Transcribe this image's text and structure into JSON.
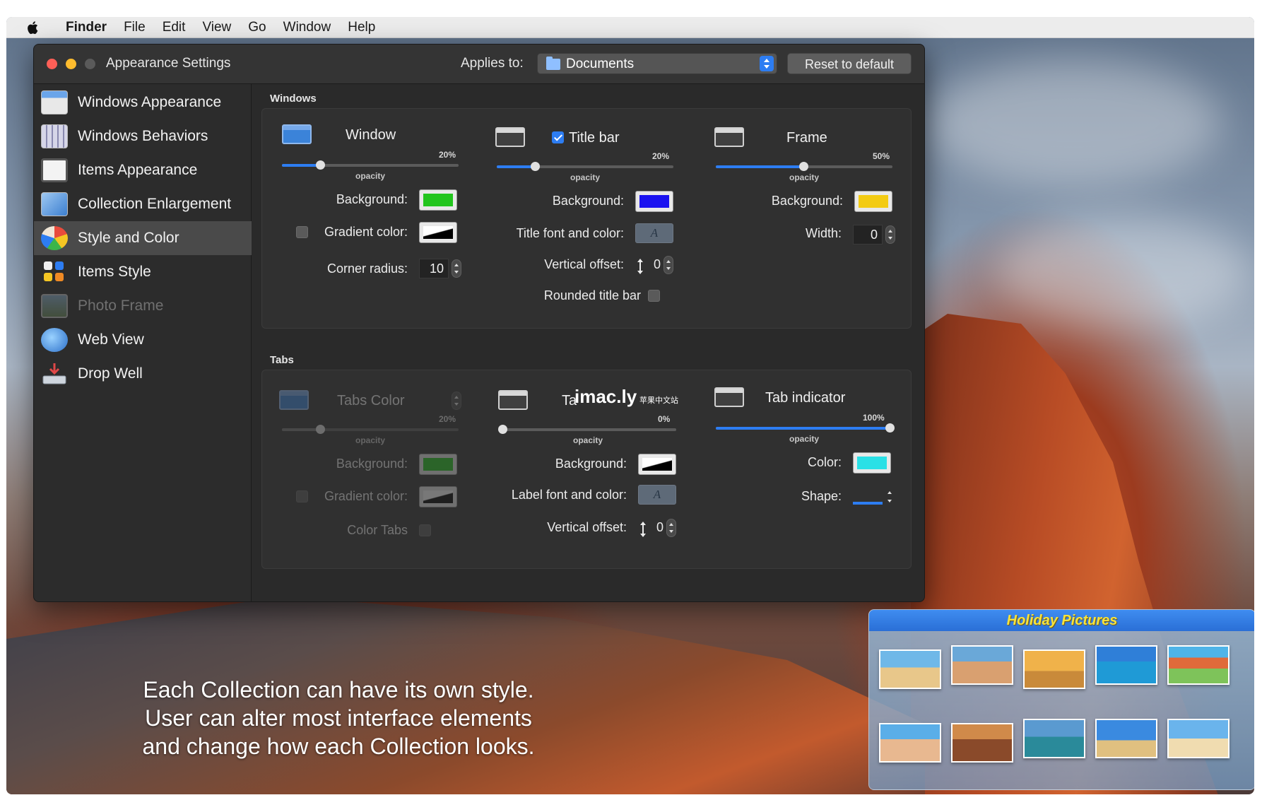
{
  "menubar": {
    "app": "Finder",
    "items": [
      "File",
      "Edit",
      "View",
      "Go",
      "Window",
      "Help"
    ]
  },
  "window": {
    "title": "Appearance Settings",
    "applies_label": "Applies to:",
    "applies_value": "Documents",
    "reset_label": "Reset to default"
  },
  "sidebar": {
    "selected": "Style and Color",
    "items": [
      {
        "label": "Windows Appearance",
        "icon": "windows-appearance-icon"
      },
      {
        "label": "Windows Behaviors",
        "icon": "windows-behaviors-icon"
      },
      {
        "label": "Items Appearance",
        "icon": "items-appearance-icon"
      },
      {
        "label": "Collection Enlargement",
        "icon": "collection-enlargement-icon"
      },
      {
        "label": "Style and Color",
        "icon": "palette-icon"
      },
      {
        "label": "Items Style",
        "icon": "items-style-icon"
      },
      {
        "label": "Photo Frame",
        "icon": "photo-frame-icon"
      },
      {
        "label": "Web View",
        "icon": "globe-icon"
      },
      {
        "label": "Drop Well",
        "icon": "drop-well-icon"
      }
    ]
  },
  "windows_section": {
    "label": "Windows",
    "window_col": {
      "title": "Window",
      "opacity_pct": "20%",
      "opacity_value": 0.2,
      "opacity_label": "opacity",
      "background_label": "Background:",
      "background_color": "#22c51d",
      "gradient_label": "Gradient color:",
      "gradient_checked": false,
      "corner_label": "Corner radius:",
      "corner_value": "10"
    },
    "titlebar_col": {
      "title": "Title bar",
      "checked": true,
      "opacity_pct": "20%",
      "opacity_value": 0.2,
      "opacity_label": "opacity",
      "background_label": "Background:",
      "background_color": "#1a12f0",
      "font_label": "Title font and color:",
      "font_glyph": "A",
      "offset_label": "Vertical offset:",
      "offset_value": "0",
      "rounded_label": "Rounded title bar",
      "rounded_checked": false
    },
    "frame_col": {
      "title": "Frame",
      "opacity_pct": "50%",
      "opacity_value": 0.5,
      "opacity_label": "opacity",
      "background_label": "Background:",
      "background_color": "#f3cb12",
      "width_label": "Width:",
      "width_value": "0"
    }
  },
  "tabs_section": {
    "label": "Tabs",
    "tabs_color_col": {
      "title": "Tabs Color",
      "opacity_pct": "20%",
      "opacity_value": 0.2,
      "opacity_label": "opacity",
      "background_label": "Background:",
      "background_color": "#22c51d",
      "gradient_label": "Gradient color:",
      "color_tabs_label": "Color Tabs"
    },
    "tab_col": {
      "title": "Ta",
      "opacity_pct": "0%",
      "opacity_value": 0.0,
      "opacity_label": "opacity",
      "background_label": "Background:",
      "font_label": "Label font and color:",
      "font_glyph": "A",
      "offset_label": "Vertical offset:",
      "offset_value": "0"
    },
    "indicator_col": {
      "title": "Tab indicator",
      "opacity_pct": "100%",
      "opacity_value": 1.0,
      "opacity_label": "opacity",
      "color_label": "Color:",
      "color_value": "#2ae0e6",
      "shape_label": "Shape:"
    }
  },
  "watermark": {
    "main": "imac.ly",
    "sub": "苹果中文站"
  },
  "tagline": [
    "Each Collection can have its own style.",
    "User can alter most interface elements",
    "and change how each Collection looks."
  ],
  "collection": {
    "title": "Holiday Pictures",
    "thumbnails": [
      "starfish-beach",
      "family-beach",
      "sunset-beach",
      "swimmer-sea",
      "tropical-drinks",
      "friends-beach",
      "group-beach",
      "kayak-bay",
      "palm-beach",
      "couple-beach"
    ]
  }
}
